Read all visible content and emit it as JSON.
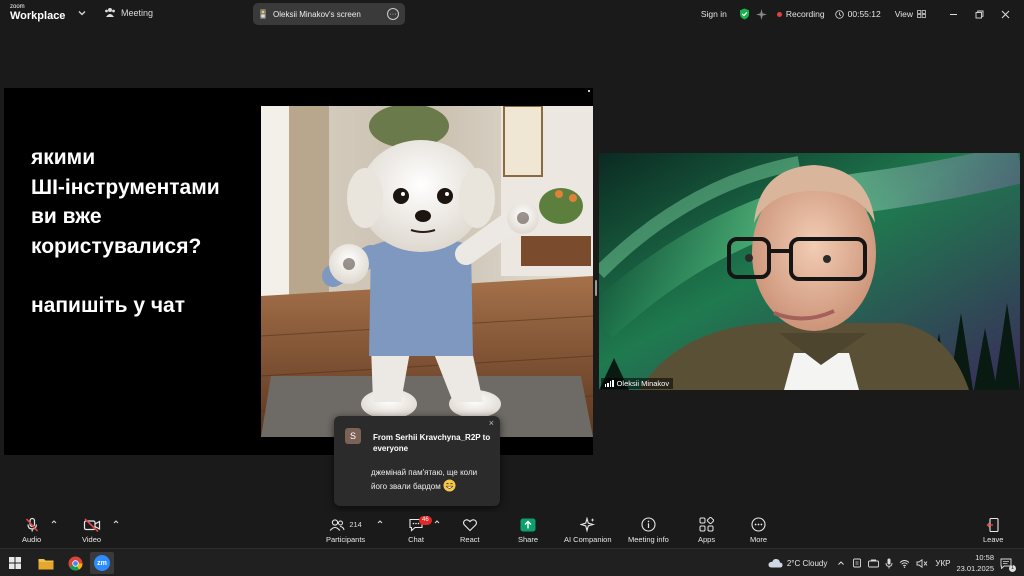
{
  "app": {
    "brand_small": "zoom",
    "brand_large": "Workplace",
    "meeting_label": "Meeting",
    "screen_share_label": "Oleksii Minakov's screen",
    "screen_more_glyph": "···",
    "sign_in": "Sign in",
    "recording_label": "Recording",
    "timer": "00:55:12",
    "view_label": "View"
  },
  "slide": {
    "question_lines": [
      "якими",
      "ШІ-інструментами",
      "ви вже",
      "користувалися?"
    ],
    "prompt": "напишіть у чат"
  },
  "video": {
    "participant_name": "Oleksii Minakov"
  },
  "chat_toast": {
    "avatar_initial": "S",
    "from": "From Serhii Kravchyna_R2P to everyone",
    "message": "джемінай пам'ятаю, ще коли його звали бардом",
    "close_glyph": "×"
  },
  "toolbar": {
    "audio": "Audio",
    "video": "Video",
    "participants": "Participants",
    "participants_count": "214",
    "chat": "Chat",
    "chat_badge": "46",
    "react": "React",
    "share": "Share",
    "ai_companion": "AI Companion",
    "meeting_info": "Meeting info",
    "apps": "Apps",
    "more": "More",
    "leave": "Leave"
  },
  "taskbar": {
    "weather": "2°C  Cloudy",
    "language": "УКР",
    "time": "10:58",
    "date": "23.01.2025",
    "notification_count": "1",
    "zoom_app_glyph": "zm"
  },
  "colors": {
    "bg": "#1a1a1a",
    "share_green": "#0e9f6e",
    "recording_red": "#e04040",
    "shield_green": "#17b34a",
    "badge_red": "#e02828",
    "leave_red": "#e05050"
  }
}
